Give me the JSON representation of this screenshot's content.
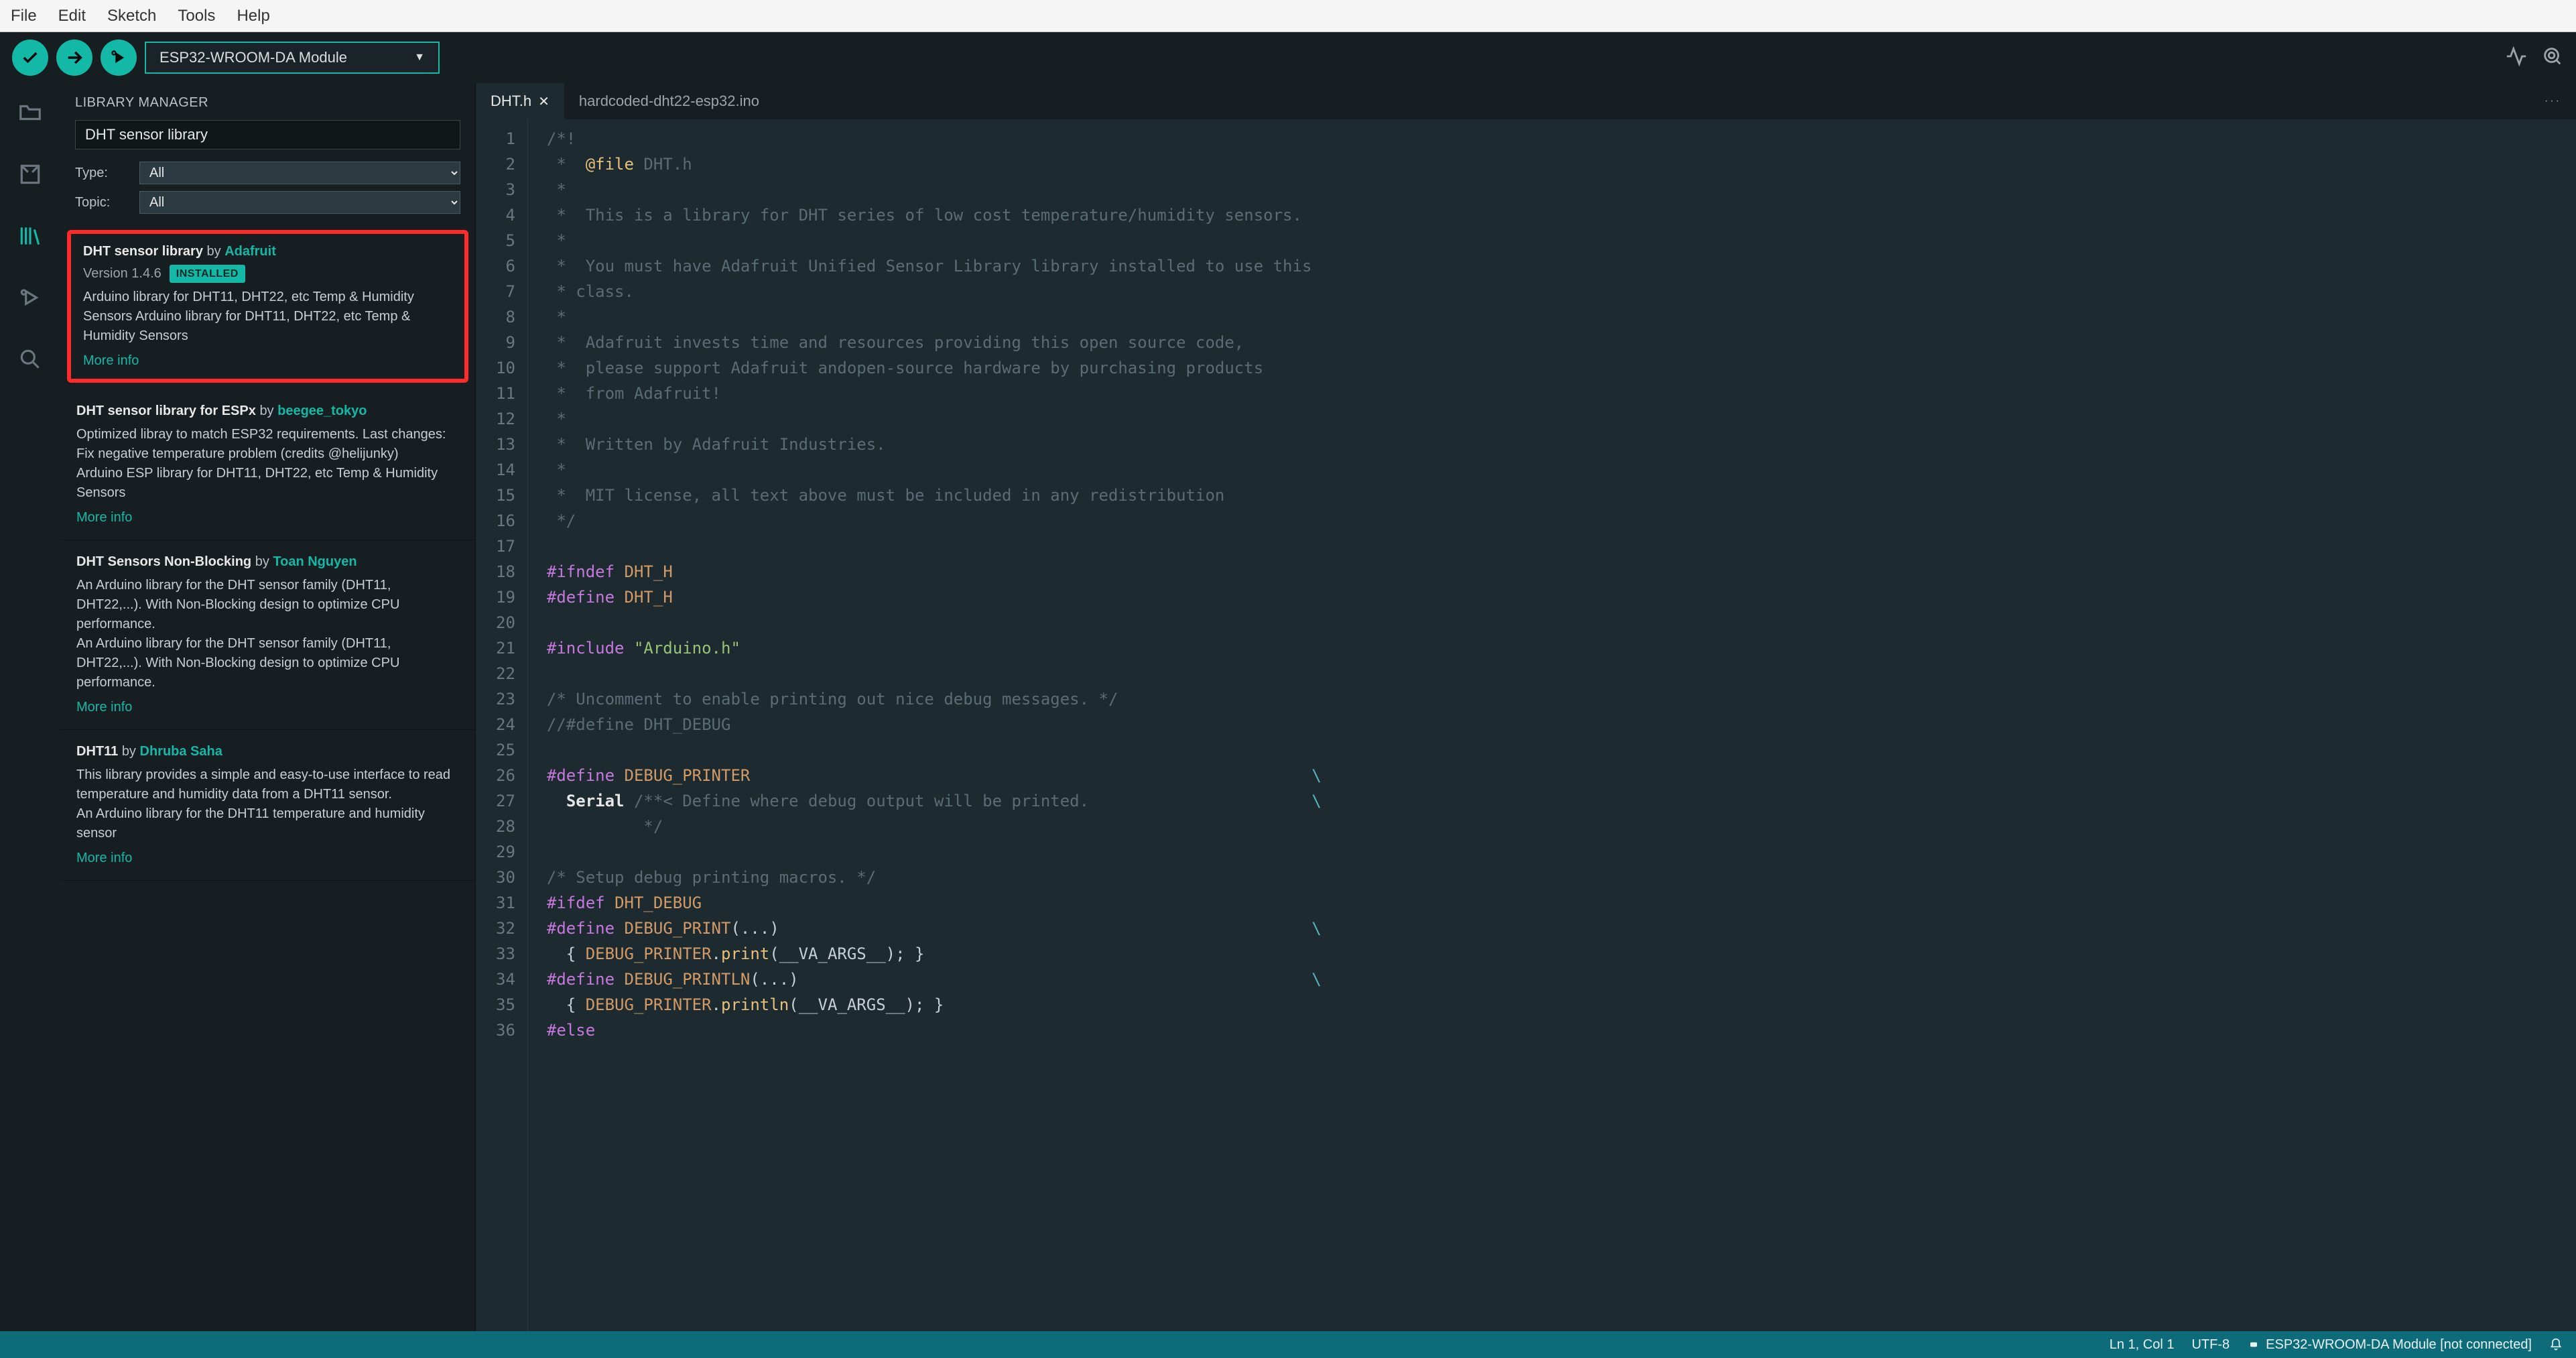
{
  "menubar": [
    "File",
    "Edit",
    "Sketch",
    "Tools",
    "Help"
  ],
  "toolbar": {
    "board": "ESP32-WROOM-DA Module"
  },
  "sidebar": {
    "title": "LIBRARY MANAGER",
    "search_value": "DHT sensor library",
    "filters": {
      "type_label": "Type:",
      "type_value": "All",
      "topic_label": "Topic:",
      "topic_value": "All"
    },
    "libraries": [
      {
        "name": "DHT sensor library",
        "by": "by",
        "author": "Adafruit",
        "version": "Version 1.4.6",
        "installed": "INSTALLED",
        "desc": "Arduino library for DHT11, DHT22, etc Temp & Humidity Sensors Arduino library for DHT11, DHT22, etc Temp & Humidity Sensors",
        "more": "More info",
        "highlighted": true
      },
      {
        "name": "DHT sensor library for ESPx",
        "by": "by",
        "author": "beegee_tokyo",
        "desc": "Optimized libray to match ESP32 requirements. Last changes: Fix negative temperature problem (credits @helijunky)\nArduino ESP library for DHT11, DHT22, etc Temp & Humidity Sensors",
        "more": "More info"
      },
      {
        "name": "DHT Sensors Non-Blocking",
        "by": "by",
        "author": "Toan Nguyen",
        "desc": "An Arduino library for the DHT sensor family (DHT11, DHT22,...). With Non-Blocking design to optimize CPU performance.\nAn Arduino library for the DHT sensor family (DHT11, DHT22,...). With Non-Blocking design to optimize CPU performance.",
        "more": "More info"
      },
      {
        "name": "DHT11",
        "by": "by",
        "author": "Dhruba Saha",
        "desc": "This library provides a simple and easy-to-use interface to read temperature and humidity data from a DHT11 sensor.\nAn Arduino library for the DHT11 temperature and humidity sensor",
        "more": "More info"
      }
    ]
  },
  "tabs": [
    {
      "label": "DHT.h",
      "active": true,
      "closable": true
    },
    {
      "label": "hardcoded-dht22-esp32.ino",
      "active": false
    }
  ],
  "code": {
    "lines": [
      {
        "n": 1,
        "html": "<span class='c-comment'>/*!</span>"
      },
      {
        "n": 2,
        "html": "<span class='c-comment'> *  </span><span class='c-macro'>@file</span><span class='c-comment'> DHT.h</span>"
      },
      {
        "n": 3,
        "html": "<span class='c-comment'> *</span>"
      },
      {
        "n": 4,
        "html": "<span class='c-comment'> *  This is a library for DHT series of low cost temperature/humidity sensors.</span>"
      },
      {
        "n": 5,
        "html": "<span class='c-comment'> *</span>"
      },
      {
        "n": 6,
        "html": "<span class='c-comment'> *  You must have Adafruit Unified Sensor Library library installed to use this</span>"
      },
      {
        "n": 7,
        "html": "<span class='c-comment'> * class.</span>"
      },
      {
        "n": 8,
        "html": "<span class='c-comment'> *</span>"
      },
      {
        "n": 9,
        "html": "<span class='c-comment'> *  Adafruit invests time and resources providing this open source code,</span>"
      },
      {
        "n": 10,
        "html": "<span class='c-comment'> *  please support Adafruit andopen-source hardware by purchasing products</span>"
      },
      {
        "n": 11,
        "html": "<span class='c-comment'> *  from Adafruit!</span>"
      },
      {
        "n": 12,
        "html": "<span class='c-comment'> *</span>"
      },
      {
        "n": 13,
        "html": "<span class='c-comment'> *  Written by Adafruit Industries.</span>"
      },
      {
        "n": 14,
        "html": "<span class='c-comment'> *</span>"
      },
      {
        "n": 15,
        "html": "<span class='c-comment'> *  MIT license, all text above must be included in any redistribution</span>"
      },
      {
        "n": 16,
        "html": "<span class='c-comment'> */</span>"
      },
      {
        "n": 17,
        "html": ""
      },
      {
        "n": 18,
        "html": "<span class='c-keyword'>#ifndef</span> <span class='c-ident'>DHT_H</span>"
      },
      {
        "n": 19,
        "html": "<span class='c-keyword'>#define</span> <span class='c-ident'>DHT_H</span>"
      },
      {
        "n": 20,
        "html": ""
      },
      {
        "n": 21,
        "html": "<span class='c-keyword'>#include</span> <span class='c-string'>\"Arduino.h\"</span>"
      },
      {
        "n": 22,
        "html": ""
      },
      {
        "n": 23,
        "html": "<span class='c-comment'>/* Uncomment to enable printing out nice debug messages. */</span>"
      },
      {
        "n": 24,
        "html": "<span class='c-comment'>//#define DHT_DEBUG</span>"
      },
      {
        "n": 25,
        "html": ""
      },
      {
        "n": 26,
        "html": "<span class='c-keyword'>#define</span> <span class='c-ident'>DEBUG_PRINTER</span>                                                          <span class='c-escape'>\\</span>"
      },
      {
        "n": 27,
        "html": "  <span class='c-bold'>Serial</span> <span class='c-comment'>/**&lt; Define where debug output will be printed.                       </span><span class='c-escape'>\\</span>"
      },
      {
        "n": 28,
        "html": "<span class='c-comment'>          */</span>"
      },
      {
        "n": 29,
        "html": ""
      },
      {
        "n": 30,
        "html": "<span class='c-comment'>/* Setup debug printing macros. */</span>"
      },
      {
        "n": 31,
        "html": "<span class='c-keyword'>#ifdef</span> <span class='c-ident'>DHT_DEBUG</span>"
      },
      {
        "n": 32,
        "html": "<span class='c-keyword'>#define</span> <span class='c-ident'>DEBUG_PRINT</span>(...)                                                       <span class='c-escape'>\\</span>"
      },
      {
        "n": 33,
        "html": "  { <span class='c-ident'>DEBUG_PRINTER</span>.<span class='c-macro'>print</span>(__VA_ARGS__); }"
      },
      {
        "n": 34,
        "html": "<span class='c-keyword'>#define</span> <span class='c-ident'>DEBUG_PRINTLN</span>(...)                                                     <span class='c-escape'>\\</span>"
      },
      {
        "n": 35,
        "html": "  { <span class='c-ident'>DEBUG_PRINTER</span>.<span class='c-macro'>println</span>(__VA_ARGS__); }"
      },
      {
        "n": 36,
        "html": "<span class='c-keyword'>#else</span>"
      }
    ]
  },
  "statusbar": {
    "position": "Ln 1, Col 1",
    "encoding": "UTF-8",
    "board_status": "ESP32-WROOM-DA Module [not connected]"
  }
}
